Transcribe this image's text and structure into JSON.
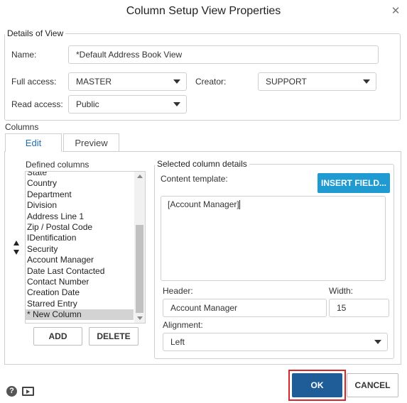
{
  "dialog": {
    "title": "Column Setup View Properties"
  },
  "details": {
    "legend": "Details of View",
    "name_label": "Name:",
    "name_value": "*Default Address Book View",
    "full_access_label": "Full access:",
    "full_access_value": "MASTER",
    "creator_label": "Creator:",
    "creator_value": "SUPPORT",
    "read_access_label": "Read access:",
    "read_access_value": "Public"
  },
  "columns": {
    "label": "Columns",
    "tabs": [
      {
        "label": "Edit"
      },
      {
        "label": "Preview"
      }
    ],
    "defined_label": "Defined columns",
    "items": [
      "State",
      "Country",
      "Department",
      "Division",
      "Address Line 1",
      "Zip / Postal Code",
      "IDentification",
      "Security",
      "Account Manager",
      "Date Last Contacted",
      "Contact Number",
      "Creation Date",
      "Starred Entry",
      "* New Column"
    ],
    "add_label": "ADD",
    "delete_label": "DELETE"
  },
  "selected": {
    "legend": "Selected column details",
    "content_template_label": "Content template:",
    "insert_field_label": "INSERT FIELD...",
    "template_value": "[Account Manager]",
    "header_label": "Header:",
    "header_value": "Account Manager",
    "width_label": "Width:",
    "width_value": "15",
    "alignment_label": "Alignment:",
    "alignment_value": "Left"
  },
  "footer": {
    "ok_label": "OK",
    "cancel_label": "CANCEL"
  },
  "icons": {
    "help": "help-icon",
    "screen": "screen-icon"
  },
  "colors": {
    "accent": "#1f9bd1",
    "ok_button": "#1e5d97",
    "highlight_border": "#d9252a"
  }
}
